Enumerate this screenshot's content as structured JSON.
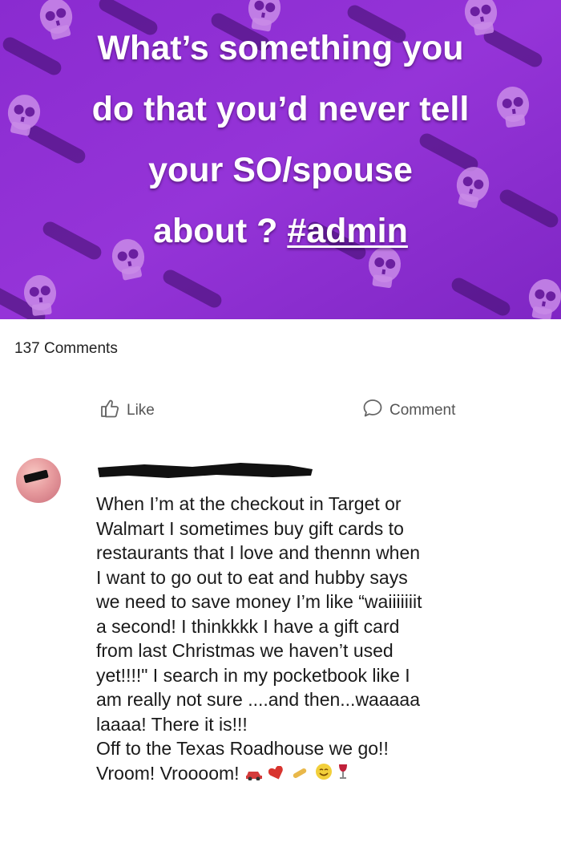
{
  "post": {
    "text_lines": [
      "What’s something you",
      "do that you’d never tell",
      "your SO/spouse",
      "about ?"
    ],
    "hashtag": "#admin",
    "banner_color": "#8e2fd3",
    "background_icons": "skull-icon"
  },
  "stats": {
    "comments": "137 Comments"
  },
  "actions": {
    "like_label": "Like",
    "comment_label": "Comment"
  },
  "comment": {
    "author_redacted": true,
    "lines": [
      "When I’m at the checkout in Target or",
      "Walmart I sometimes buy gift cards to",
      "restaurants that I love and thennn when",
      "I want to go out to eat and hubby says",
      "we need to save money I’m like “waiiiiiiit",
      "a second! I thinkkkk I have a gift card",
      "from last Christmas we haven’t used",
      "yet!!!!\" I search in my pocketbook like I",
      "am really not sure ....and then...waaaaa",
      "laaaa! There it is!!!",
      "Off to the Texas Roadhouse we go!!",
      "Vroom!  Vroooom!"
    ],
    "emojis": [
      "car-icon",
      "heart-icon",
      "bone-icon",
      "smile-icon",
      "wine-glass-icon"
    ]
  }
}
